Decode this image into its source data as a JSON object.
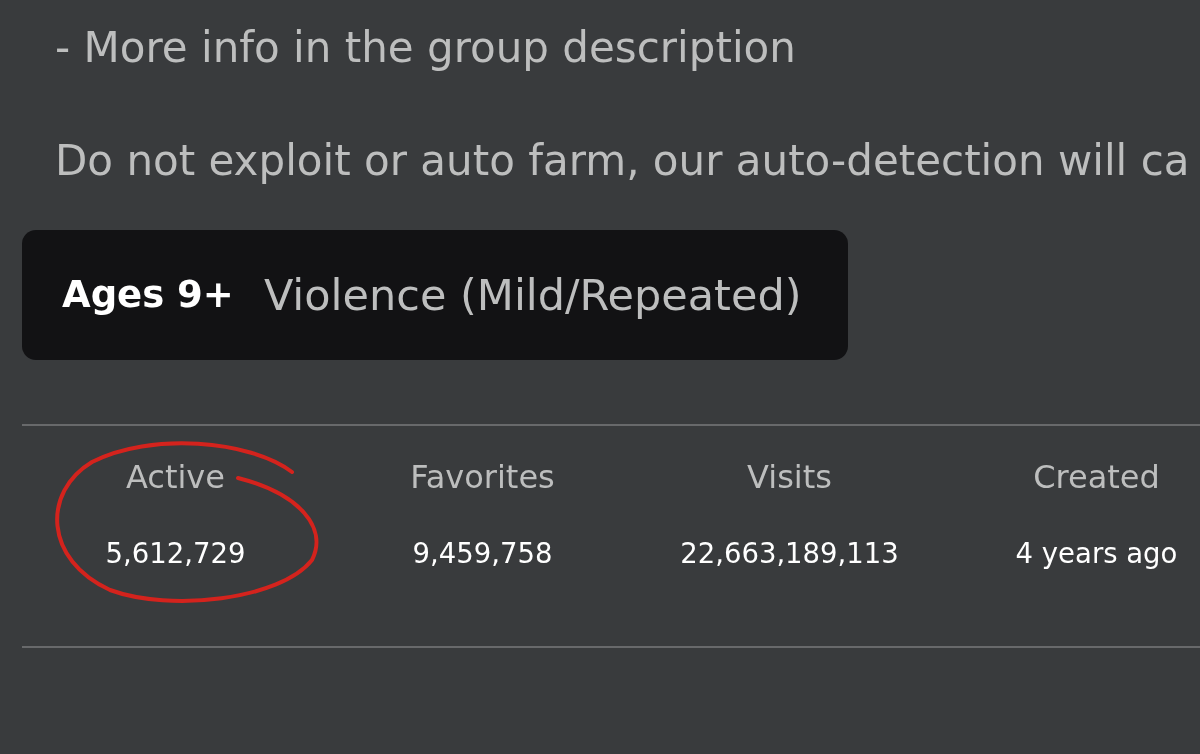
{
  "description": {
    "paragraphs": [
      [
        "- More info in the group description"
      ],
      [
        "Do not exploit or auto farm, our auto-detection will ca"
      ]
    ]
  },
  "maturity": {
    "age": "Ages 9+",
    "descriptor": "Violence (Mild/Repeated)"
  },
  "stats": [
    {
      "label": "Active",
      "value": "5,612,729",
      "circled": true
    },
    {
      "label": "Favorites",
      "value": "9,459,758",
      "circled": false
    },
    {
      "label": "Visits",
      "value": "22,663,189,113",
      "circled": false
    },
    {
      "label": "Created",
      "value": "4 years ago",
      "circled": false
    }
  ]
}
